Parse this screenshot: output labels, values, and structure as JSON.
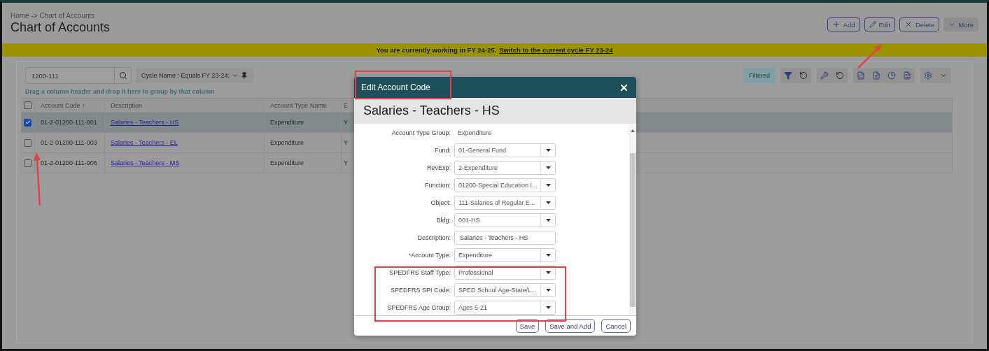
{
  "breadcrumb": "Home -> Chart of Accounts",
  "title": "Chart of Accounts",
  "actions": [
    {
      "label": "Add",
      "kind": "add"
    },
    {
      "label": "Edit",
      "kind": "edit"
    },
    {
      "label": "Delete",
      "kind": "delete"
    },
    {
      "label": "More",
      "kind": "more"
    }
  ],
  "banner": {
    "text": "You are currently working in FY 24-25.",
    "link": "Switch to the current cycle FY 23-24"
  },
  "search": {
    "value": "1200-111"
  },
  "filter_chip": "Cycle Name : Equals FY 23-24;",
  "group_hint": "Drag a column header and drop it here to group by that column",
  "toolbar": {
    "filtered_label": "Filtered"
  },
  "table": {
    "header_checked": false,
    "columns": [
      {
        "label": "Account Code",
        "sort_mark": "↑"
      },
      {
        "label": "Description"
      },
      {
        "label": "Account Type Name"
      },
      {
        "label": "E"
      }
    ],
    "rows": [
      {
        "selected": true,
        "cells": [
          "01-2-01200-111-001",
          "Salaries - Teachers - HS",
          "Expenditure",
          "Y"
        ]
      },
      {
        "selected": false,
        "cells": [
          "01-2-01200-111-003",
          "Salaries - Teachers - EL",
          "Expenditure",
          "Y"
        ]
      },
      {
        "selected": false,
        "cells": [
          "01-2-01200-111-006",
          "Salaries - Teachers - MS",
          "Expenditure",
          "Y"
        ]
      }
    ]
  },
  "dialog": {
    "title": "Edit Account Code",
    "heading": "Salaries - Teachers - HS",
    "fields": [
      {
        "label": "Account Type Group:",
        "kind": "static",
        "value": "Expenditure"
      },
      {
        "label": "Fund:",
        "kind": "select",
        "value": "01-General Fund"
      },
      {
        "label": "RevExp:",
        "kind": "select",
        "value": "2-Expenditure"
      },
      {
        "label": "Function:",
        "kind": "select",
        "value": "01200-Special Education I..."
      },
      {
        "label": "Object:",
        "kind": "select",
        "value": "111-Salaries of Regular E..."
      },
      {
        "label": "Bldg:",
        "kind": "select",
        "value": "001-HS"
      },
      {
        "label": "Description:",
        "kind": "text",
        "value": "Salaries - Teachers - HS"
      },
      {
        "label": "Account Type:",
        "required_mark": "*",
        "kind": "select",
        "value": "Expenditure"
      },
      {
        "label": "SPEDFRS Staff Type:",
        "kind": "select",
        "value": "Professional"
      },
      {
        "label": "SPEDFRS SPI Code:",
        "kind": "select",
        "value": "SPED School Age-State/L..."
      },
      {
        "label": "SPEDFRS Age Group:",
        "kind": "select",
        "value": "Ages 5-21"
      }
    ],
    "buttons": [
      "Save",
      "Save and Add",
      "Cancel"
    ]
  }
}
